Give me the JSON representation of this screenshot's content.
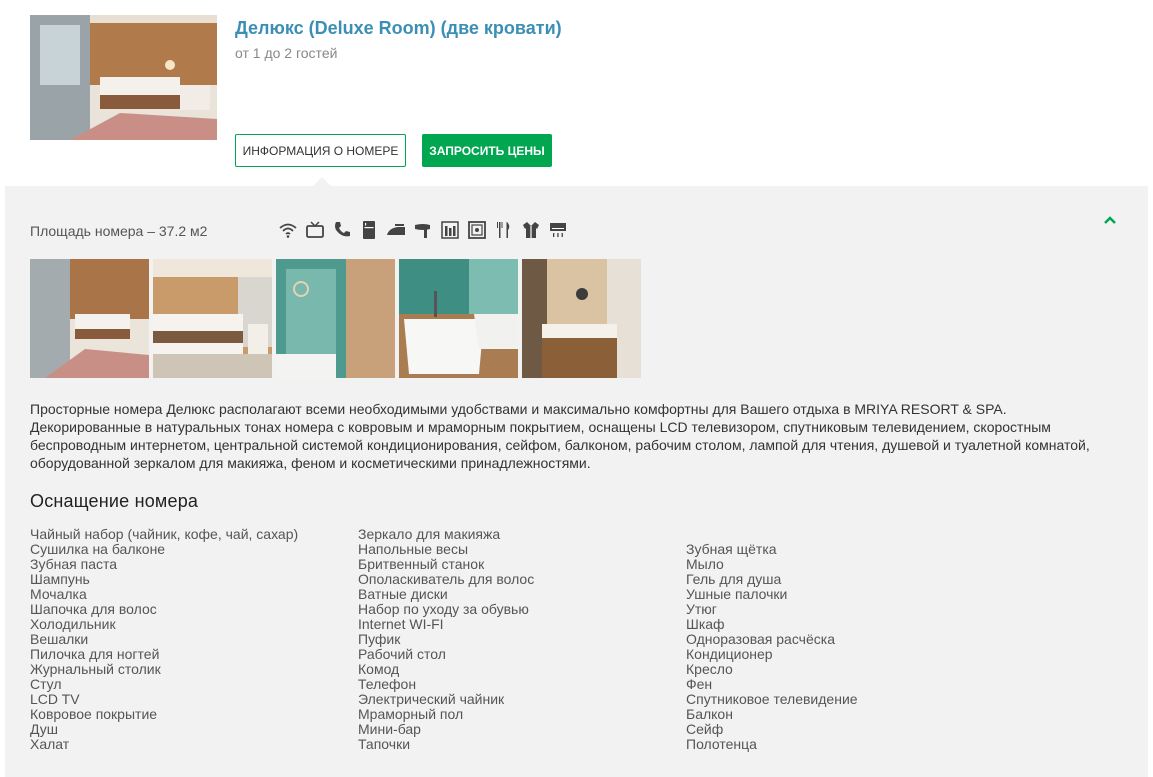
{
  "room": {
    "title": "Делюкс (Deluxe Room) (две кровати)",
    "guests": "от 1 до 2 гостей",
    "info_button": "ИНФОРМАЦИЯ О НОМЕРЕ",
    "price_button": "ЗАПРОСИТЬ ЦЕНЫ"
  },
  "details": {
    "area": "Площадь номера – 37.2 м2",
    "amenity_icons": [
      "wifi-icon",
      "tv-icon",
      "phone-icon",
      "fridge-icon",
      "iron-icon",
      "hairdryer-icon",
      "minibar-icon",
      "safe-icon",
      "dining-icon",
      "bathrobe-icon",
      "air-conditioner-icon"
    ],
    "gallery": [
      "room-photo-1",
      "room-photo-2",
      "bathroom-photo-1",
      "bathroom-photo-2",
      "bathroom-photo-3"
    ],
    "description": "Просторные номера Делюкс располагают всеми необходимыми удобствами и максимально комфортны для Вашего отдыха в MRIYA RESORT & SPA. Декорированные в натуральных тонах номера с ковровым и мраморным покрытием, оснащены LCD телевизором, спутниковым телевидением, скоростным беспроводным интернетом, центральной системой кондиционирования, сейфом, балконом, рабочим столом, лампой для чтения, душевой и туалетной комнатой, оборудованной зеркалом для макияжа, феном и косметическими принадлежностями.",
    "equipment_title": "Оснащение номера",
    "equipment": {
      "col1": [
        "Чайный набор (чайник, кофе, чай, сахар)",
        "Сушилка на балконе",
        "Зубная паста",
        "Шампунь",
        "Мочалка",
        "Шапочка для волос",
        "Холодильник",
        "Вешалки",
        "Пилочка для ногтей",
        "Журнальный столик",
        "Стул",
        "LCD TV",
        "Ковровое покрытие",
        "Душ",
        "Халат"
      ],
      "col2": [
        "Зеркало для макияжа",
        "Напольные весы",
        "Бритвенный станок",
        "Ополаскиватель для волос",
        "Ватные диски",
        "Набор по уходу за обувью",
        "Internet WI-FI",
        "Пуфик",
        "Рабочий стол",
        "Комод",
        "Телефон",
        "Электрический чайник",
        "Мраморный пол",
        "Мини-бар",
        "Тапочки"
      ],
      "col3": [
        "Зубная щётка",
        "Мыло",
        "Гель для душа",
        "Ушные палочки",
        "Утюг",
        "Шкаф",
        "Одноразовая расчёска",
        "Кондиционер",
        "Кресло",
        "Фен",
        "Спутниковое телевидение",
        "Балкон",
        "Сейф",
        "Полотенца"
      ]
    }
  },
  "colors": {
    "accent_green": "#00a650",
    "title_blue": "#3b8fb5",
    "panel_bg": "#f2f2f2"
  }
}
